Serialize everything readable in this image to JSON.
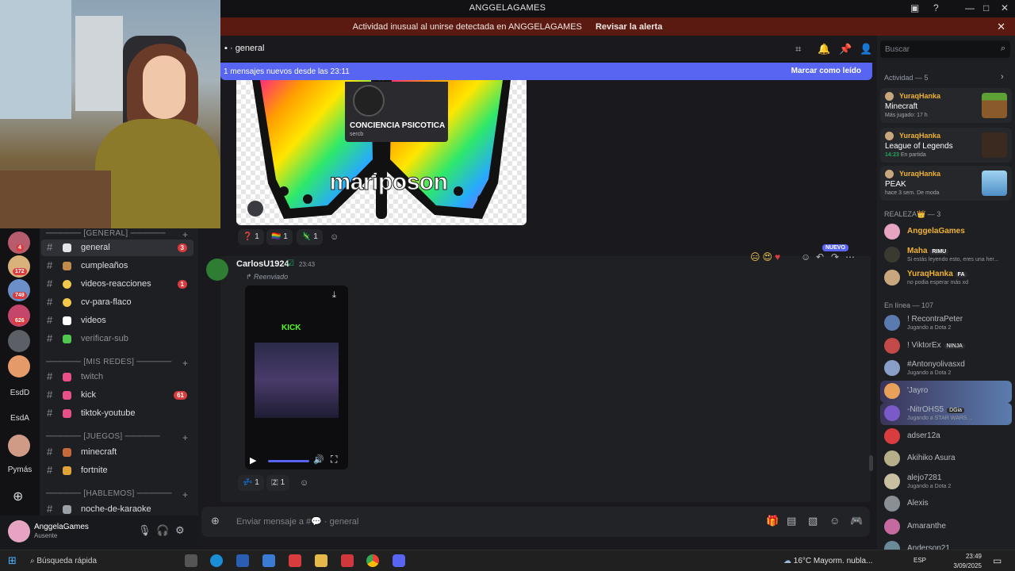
{
  "window": {
    "title": "ANGGELAGAMES"
  },
  "alert": {
    "text": "Actividad inusual al unirse detectada en ANGGELAGAMES",
    "action": "Revisar la alerta"
  },
  "servers": {
    "badges": [
      "4",
      "172",
      "749",
      "626"
    ],
    "labels": [
      "EsdD",
      "EsdA",
      "Pymás"
    ]
  },
  "channel_list": {
    "categories": [
      "────── [GENERAL] ──────",
      "────── [MIS REDES] ──────",
      "────── [JUEGOS] ──────",
      "────── [HABLEMOS] ──────"
    ],
    "channels": [
      {
        "name": "general",
        "badge": "3"
      },
      {
        "name": "cumpleaños",
        "badge": ""
      },
      {
        "name": "videos-reacciones",
        "badge": "1"
      },
      {
        "name": "cv-para-flaco",
        "badge": ""
      },
      {
        "name": "videos",
        "badge": ""
      },
      {
        "name": "verificar-sub",
        "badge": ""
      },
      {
        "name": "twitch",
        "badge": ""
      },
      {
        "name": "kick",
        "badge": "61"
      },
      {
        "name": "tiktok-youtube",
        "badge": ""
      },
      {
        "name": "minecraft",
        "badge": ""
      },
      {
        "name": "fortnite",
        "badge": ""
      },
      {
        "name": "noche-de-karaoke",
        "badge": ""
      }
    ]
  },
  "user_panel": {
    "name": "AnggelaGames",
    "status": "Ausente"
  },
  "header": {
    "channel": "general"
  },
  "new_banner": {
    "text": "1 mensajes nuevos desde las 23:11",
    "action": "Marcar como leído"
  },
  "image_message": {
    "caption": "mariposon",
    "card_title": "CONCIENCIA PSICOTICA",
    "card_sub": "sercb",
    "reactions": [
      {
        "emoji": "❓",
        "count": "1"
      },
      {
        "emoji": "🏳️‍🌈",
        "count": "1"
      },
      {
        "emoji": "🦎",
        "count": "1"
      }
    ]
  },
  "message": {
    "author": "CarlosU1924",
    "time": "23:43",
    "forwarded": "Reenviado",
    "new_tag": "NUEVO",
    "video_brand": "KICK",
    "reactions": [
      {
        "emoji": "💤",
        "count": "1"
      },
      {
        "emoji": "🇿",
        "count": "1"
      }
    ]
  },
  "input": {
    "placeholder": "Enviar mensaje a #💬 · general"
  },
  "search": {
    "placeholder": "Buscar"
  },
  "activity": {
    "title": "Actividad — 5",
    "items": [
      {
        "user": "YuraqHanka",
        "game": "Minecraft",
        "meta": "Más jugado: 17 h",
        "meta2": ""
      },
      {
        "user": "YuraqHanka",
        "game": "League of Legends",
        "meta": "14:23",
        "meta2": "En partida"
      },
      {
        "user": "YuraqHanka",
        "game": "PEAK",
        "meta": "hace 3 sem.",
        "meta2": "De moda"
      }
    ]
  },
  "realeza": {
    "title": "REALEZA👑 — 3",
    "members": [
      {
        "name": "AnggelaGames",
        "tag": "",
        "sub": ""
      },
      {
        "name": "Maha",
        "tag": "RIMU",
        "sub": "Si estás leyendo esto, eres una her..."
      },
      {
        "name": "YuraqHanka",
        "tag": "FA",
        "sub": "no podia esperar más xd"
      }
    ]
  },
  "online": {
    "title": "En línea — 107",
    "members": [
      {
        "name": "! RecontraPeter",
        "tag": "",
        "sub": "Jugando a Dota 2"
      },
      {
        "name": "! ViktorEx",
        "tag": "NINJA",
        "sub": ""
      },
      {
        "name": "#Antonyolivasxd",
        "tag": "",
        "sub": "Jugando a Dota 2"
      },
      {
        "name": "'Jayro",
        "tag": "",
        "sub": ""
      },
      {
        "name": "-NitrOHS5",
        "tag": "DGia",
        "sub": "Jugando a STAR WARS..."
      },
      {
        "name": "adser12a",
        "tag": "",
        "sub": ""
      },
      {
        "name": "Akihiko Asura",
        "tag": "",
        "sub": ""
      },
      {
        "name": "alejo7281",
        "tag": "",
        "sub": "Jugando a Dota 2"
      },
      {
        "name": "Alexis",
        "tag": "",
        "sub": ""
      },
      {
        "name": "Amaranthe",
        "tag": "",
        "sub": ""
      },
      {
        "name": "Anderson21",
        "tag": "",
        "sub": ""
      }
    ]
  },
  "taskbar": {
    "search": "Búsqueda rápida",
    "weather": "16°C  Mayorm. nubla...",
    "lang": "ESP",
    "time": "23:49",
    "date": "3/09/2025"
  },
  "colors": {
    "accent": "#5865f2",
    "alert": "#5a1a12",
    "mention": "#d83c3e",
    "online": "#23a55a"
  }
}
